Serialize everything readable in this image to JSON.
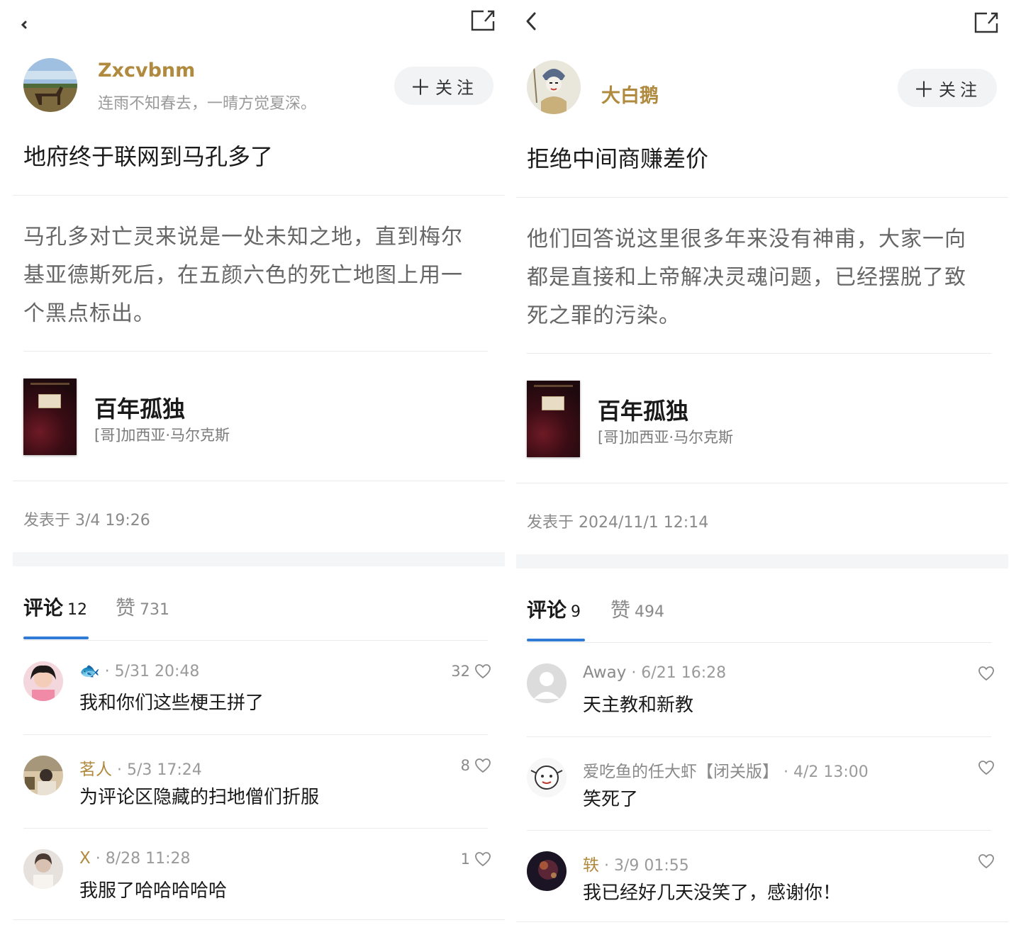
{
  "panels": [
    {
      "author": {
        "name": "Zxcvbnm",
        "signature": "连雨不知春去，一晴方觉夏深。"
      },
      "follow_label": "关注",
      "title": "地府终于联网到马孔多了",
      "excerpt": "马孔多对亡灵来说是一处未知之地，直到梅尔基亚德斯死后，在五颜六色的死亡地图上用一个黑点标出。",
      "book": {
        "title": "百年孤独",
        "author": "[哥]加西亚·马尔克斯"
      },
      "posted": "发表于 3/4 19:26",
      "tabs": [
        {
          "label": "评论",
          "count": "12"
        },
        {
          "label": "赞",
          "count": "731"
        }
      ],
      "comments": [
        {
          "name": "🐟",
          "time": " · 5/31 20:48",
          "text": "我和你们这些梗王拼了",
          "likes": "32"
        },
        {
          "name": "茗人",
          "time": " · 5/3 17:24",
          "text": "为评论区隐藏的扫地僧们折服",
          "likes": "8"
        },
        {
          "name": "X",
          "time": " · 8/28 11:28",
          "text": "我服了哈哈哈哈哈",
          "likes": "1"
        }
      ]
    },
    {
      "author": {
        "name": "大白鹅",
        "signature": ""
      },
      "follow_label": "关注",
      "title": "拒绝中间商赚差价",
      "excerpt": "他们回答说这里很多年来没有神甫，大家一向都是直接和上帝解决灵魂问题，已经摆脱了致死之罪的污染。",
      "book": {
        "title": "百年孤独",
        "author": "[哥]加西亚·马尔克斯"
      },
      "posted": "发表于 2024/11/1 12:14",
      "tabs": [
        {
          "label": "评论",
          "count": "9"
        },
        {
          "label": "赞",
          "count": "494"
        }
      ],
      "comments": [
        {
          "name": "Away",
          "time": " · 6/21 16:28",
          "text": "天主教和新教",
          "likes": ""
        },
        {
          "name": "爱吃鱼的任大虾【闭关版】",
          "time": " · 4/2 13:00",
          "text": "笑死了",
          "likes": ""
        },
        {
          "name": "轶",
          "time": " · 3/9 01:55",
          "text": "我已经好几天没笑了，感谢你！",
          "likes": ""
        }
      ]
    }
  ],
  "icons": {
    "back": "chevron-left-icon",
    "share": "share-icon",
    "like": "heart-outline-icon",
    "follow": "plus-icon"
  },
  "colors": {
    "author_name": "#b08a3e",
    "tab_underline": "#2f7bd6",
    "muted_text": "#9a9a9a"
  }
}
